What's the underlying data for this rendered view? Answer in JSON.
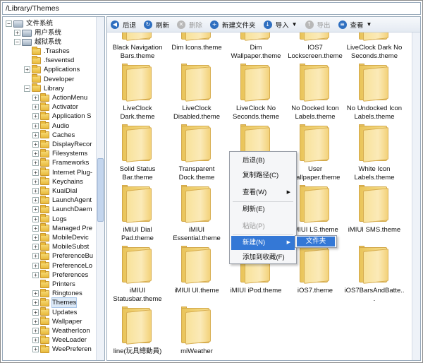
{
  "path": "/Library/Themes",
  "toolbar": {
    "back": "后退",
    "refresh": "刷新",
    "delete": "删除",
    "new_folder": "新建文件夹",
    "import": "导入",
    "export": "导出",
    "view": "查看"
  },
  "tree": {
    "root": "文件系统",
    "user_system": "用户系统",
    "jailbreak_system": "越狱系统",
    "items": [
      ".Trashes",
      ".fseventsd",
      "Applications",
      "Developer",
      "Library",
      "ActionMenu",
      "Activator",
      "Application S",
      "Audio",
      "Caches",
      "DisplayRecor",
      "Filesystems",
      "Frameworks",
      "Internet Plug-",
      "Keychains",
      "KuaiDial",
      "LaunchAgent",
      "LaunchDaem",
      "Logs",
      "Managed Pre",
      "MobileDevic",
      "MobileSubst",
      "PreferenceBu",
      "PreferenceLo",
      "Preferences",
      "Printers",
      "Ringtones",
      "Themes",
      "Updates",
      "Wallpaper",
      "WeatherIcon",
      "WeeLoader",
      "WeePreferen"
    ]
  },
  "folders": [
    "Black Navigation Bars.theme",
    "Dim Icons.theme",
    "Dim Wallpaper.theme",
    "IOS7 Lockscreen.theme",
    "LiveClock Dark No Seconds.theme",
    "LiveClock Dark.theme",
    "LiveClock Disabled.theme",
    "LiveClock No Seconds.theme",
    "No Docked Icon Labels.theme",
    "No Undocked Icon Labels.theme",
    "Solid Status Bar.theme",
    "Transparent Dock.theme",
    "",
    "User Wallpaper.theme",
    "White Icon Labels.theme",
    "iMIUI Dial Pad.theme",
    "iMIUI Essential.theme",
    "",
    "iMIUI LS.theme",
    "iMIUI SMS.theme",
    "iMIUI Statusbar.theme",
    "iMIUI UI.theme",
    "iMIUI iPod.theme",
    "iOS7.theme",
    "iOS7BarsAndBatte...",
    "line(玩具總動員)",
    "miWeather"
  ],
  "context_menu": {
    "back": "后退(B)",
    "copy_path": "复制路径(C)",
    "view": "查看(W)",
    "refresh": "刷新(E)",
    "paste": "粘贴(P)",
    "new": "新建(N)",
    "add_favorite": "添加到收藏(F)",
    "submenu_folder": "文件夹"
  }
}
